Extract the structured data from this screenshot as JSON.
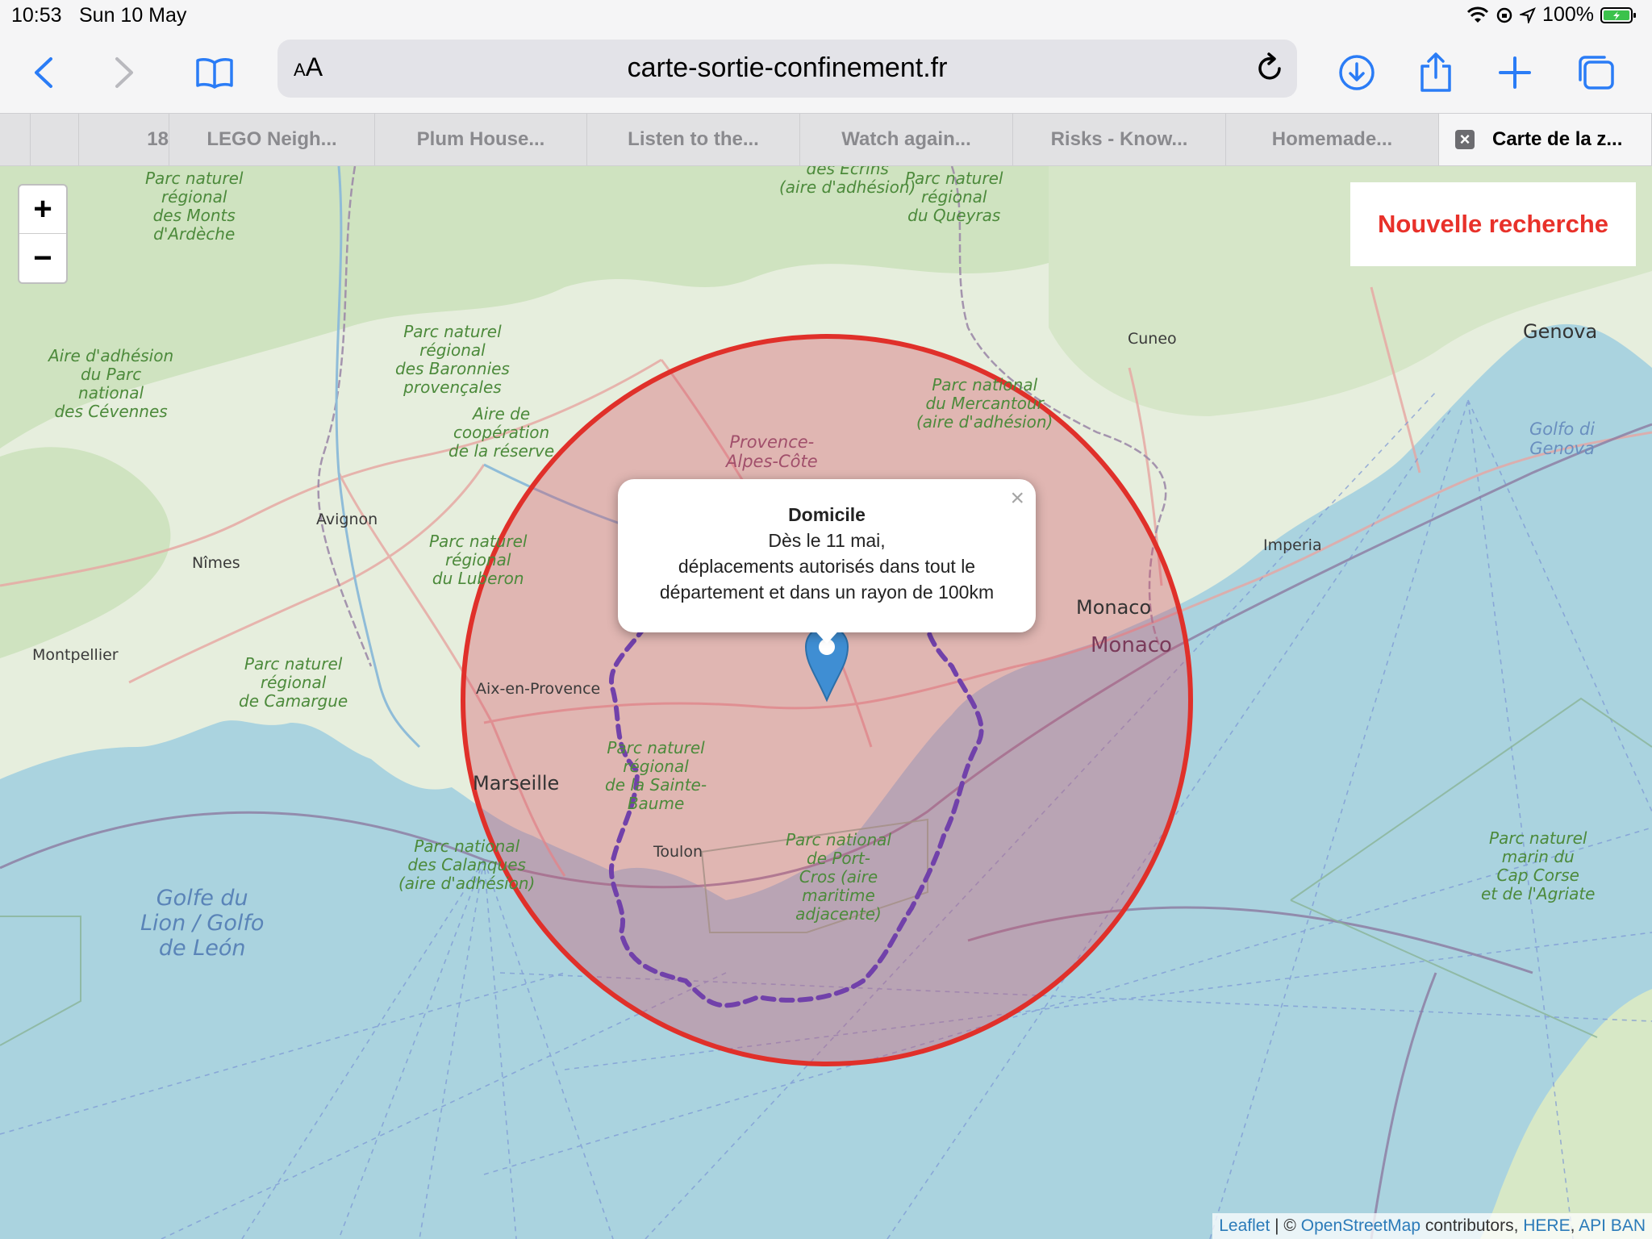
{
  "status_bar": {
    "time": "10:53",
    "date": "Sun 10 May",
    "battery": "100%"
  },
  "toolbar": {
    "url": "carte-sortie-confinement.fr",
    "text_size_label_small": "A",
    "text_size_label_large": "A"
  },
  "tabs": [
    {
      "label": "18",
      "active": false
    },
    {
      "label": "LEGO Neigh...",
      "active": false
    },
    {
      "label": "Plum House...",
      "active": false
    },
    {
      "label": "Listen to the...",
      "active": false
    },
    {
      "label": "Watch again...",
      "active": false
    },
    {
      "label": "Risks - Know...",
      "active": false
    },
    {
      "label": "Homemade...",
      "active": false
    },
    {
      "label": "Carte de la z...",
      "active": true
    }
  ],
  "map": {
    "zoom_in": "+",
    "zoom_out": "−",
    "new_search": "Nouvelle recherche",
    "popup": {
      "title": "Domicile",
      "line1": "Dès le 11 mai,",
      "line2": "déplacements autorisés dans tout le",
      "line3": "département et dans un rayon de 100km",
      "close": "×"
    },
    "circle_color": "#e0302a",
    "circle_fill": "rgba(214,72,96,0.34)",
    "department_border_color": "#3d3dd1",
    "marker_color": "#3f8ed3",
    "labels": {
      "ardeche": "Parc naturel\nrégional\ndes Monts\nd'Ardèche",
      "cevennes": "Aire d'adhésion\ndu Parc\nnational\ndes Cévennes",
      "baronnies": "Parc naturel\nrégional\ndes Baronnies\nprovençales",
      "cooperation": "Aire de\ncoopération\nde la réserve",
      "luberon": "Parc naturel\nrégional\ndu Luberon",
      "camargue": "Parc naturel\nrégional\nde Camargue",
      "calanques": "Parc national\ndes Calanques\n(aire d'adhésion)",
      "sainte_baume": "Parc naturel\nrégional\nde la Sainte-\nBaume",
      "port_cros": "Parc national\nde Port-\nCros (aire\nmaritime\nadjacente)",
      "mercantour": "Parc national\ndu Mercantour\n(aire d'adhésion)",
      "queyras": "Parc naturel\nrégional\ndu Queyras",
      "ecrins": "des Écrins\n(aire d'adhésion)",
      "cap_corse": "Parc naturel\nmarin du\nCap Corse\net de l'Agriate",
      "provence": "Provence-\nAlpes-Côte",
      "golfe_lion": "Golfe du\nLion / Golfo\nde León",
      "golfo_genova": "Golfo di\nGenova",
      "avignon": "Avignon",
      "nimes": "Nîmes",
      "montpellier": "Montpellier",
      "aix": "Aix-en-Provence",
      "marseille": "Marseille",
      "toulon": "Toulon",
      "cuneo": "Cuneo",
      "genova": "Genova",
      "imperia": "Imperia",
      "monaco": "Monaco",
      "monaco2": "Monaco"
    }
  },
  "attribution": {
    "leaflet": "Leaflet",
    "sep1": " | © ",
    "osm": "OpenStreetMap",
    "contributors": " contributors, ",
    "here": "HERE",
    "comma": ", ",
    "apiban": "API BAN"
  }
}
